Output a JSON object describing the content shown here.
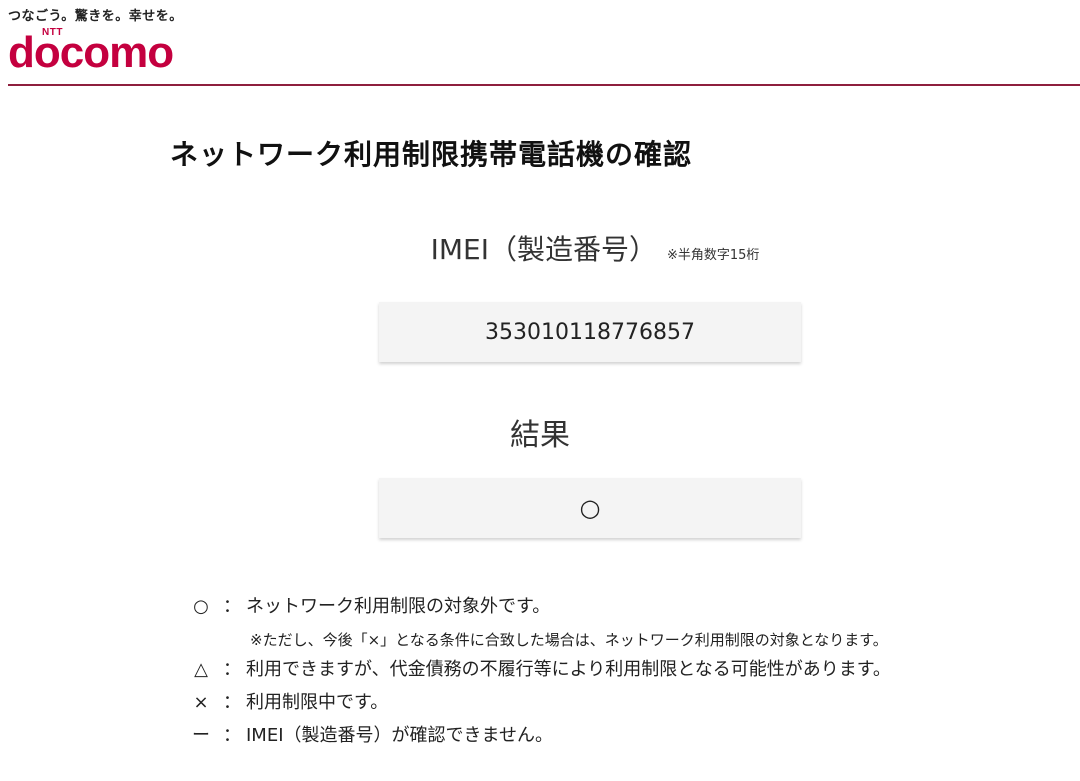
{
  "header": {
    "tagline": "つなごう。驚きを。幸せを。",
    "logo_ntt": "NTT",
    "logo_word": "docomo",
    "brand_color": "#c4003f"
  },
  "page": {
    "title": "ネットワーク利用制限携帯電話機の確認"
  },
  "imei": {
    "label": "IMEI（製造番号）",
    "note": "※半角数字15桁",
    "value": "353010118776857"
  },
  "result": {
    "label": "結果",
    "value": "○"
  },
  "legend": {
    "items": [
      {
        "symbol": "○",
        "colon": "：",
        "text": "ネットワーク利用制限の対象外です。"
      },
      {
        "symbol": "△",
        "colon": "：",
        "text": "利用できますが、代金債務の不履行等により利用制限となる可能性があります。"
      },
      {
        "symbol": "×",
        "colon": "：",
        "text": "利用制限中です。"
      },
      {
        "symbol": "ー",
        "colon": "：",
        "text": "IMEI（製造番号）が確認できません。"
      }
    ],
    "subnote": "※ただし、今後「×」となる条件に合致した場合は、ネットワーク利用制限の対象となります。"
  }
}
